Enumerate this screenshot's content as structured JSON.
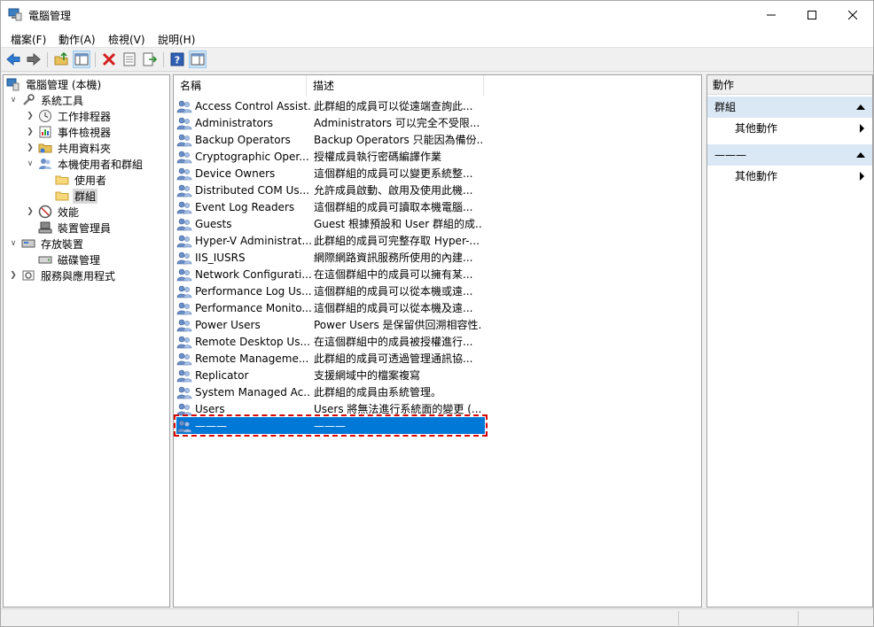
{
  "window": {
    "title": "電腦管理"
  },
  "menubar": {
    "items": [
      "檔案(F)",
      "動作(A)",
      "檢視(V)",
      "說明(H)"
    ]
  },
  "toolbar": {
    "buttons": [
      "back-icon",
      "forward-icon",
      "up-folder-icon",
      "show-hide-tree-icon",
      "delete-icon",
      "properties-icon",
      "export-icon",
      "help-icon",
      "show-hide-action-icon"
    ]
  },
  "tree": {
    "items": [
      {
        "label": "電腦管理 (本機)",
        "icon": "computer-management-icon"
      },
      {
        "label": "系統工具",
        "icon": "tools-icon"
      },
      {
        "label": "工作排程器",
        "icon": "clock-icon"
      },
      {
        "label": "事件檢視器",
        "icon": "event-viewer-icon"
      },
      {
        "label": "共用資料夾",
        "icon": "shared-folder-icon"
      },
      {
        "label": "本機使用者和群組",
        "icon": "users-groups-icon"
      },
      {
        "label": "使用者",
        "icon": "folder-icon"
      },
      {
        "label": "群組",
        "icon": "folder-icon"
      },
      {
        "label": "效能",
        "icon": "performance-icon"
      },
      {
        "label": "裝置管理員",
        "icon": "device-manager-icon"
      },
      {
        "label": "存放裝置",
        "icon": "storage-icon"
      },
      {
        "label": "磁碟管理",
        "icon": "disk-icon"
      },
      {
        "label": "服務與應用程式",
        "icon": "services-icon"
      }
    ]
  },
  "list": {
    "columns": {
      "name": "名稱",
      "desc": "描述"
    },
    "rows": [
      {
        "name": "Access Control Assist...",
        "desc": "此群組的成員可以從遠端查詢此..."
      },
      {
        "name": "Administrators",
        "desc": "Administrators 可以完全不受限..."
      },
      {
        "name": "Backup Operators",
        "desc": "Backup Operators 只能因為備份..."
      },
      {
        "name": "Cryptographic Oper...",
        "desc": "授權成員執行密碼編譯作業"
      },
      {
        "name": "Device Owners",
        "desc": "這個群組的成員可以變更系統整..."
      },
      {
        "name": "Distributed COM Us...",
        "desc": "允許成員啟動、啟用及使用此機..."
      },
      {
        "name": "Event Log Readers",
        "desc": "這個群組的成員可讀取本機電腦..."
      },
      {
        "name": "Guests",
        "desc": "Guest 根據預設和 User 群組的成..."
      },
      {
        "name": "Hyper-V Administrat...",
        "desc": "此群組的成員可完整存取 Hyper-..."
      },
      {
        "name": "IIS_IUSRS",
        "desc": "網際網路資訊服務所使用的內建..."
      },
      {
        "name": "Network Configurati...",
        "desc": "在這個群組中的成員可以擁有某..."
      },
      {
        "name": "Performance Log Us...",
        "desc": "這個群組的成員可以從本機或遠..."
      },
      {
        "name": "Performance Monito...",
        "desc": "這個群組的成員可以從本機及遠..."
      },
      {
        "name": "Power Users",
        "desc": "Power Users 是保留供回溯相容性..."
      },
      {
        "name": "Remote Desktop Us...",
        "desc": "在這個群組中的成員被授權進行..."
      },
      {
        "name": "Remote Manageme...",
        "desc": "此群組的成員可透過管理通訊協..."
      },
      {
        "name": "Replicator",
        "desc": "支援網域中的檔案複寫"
      },
      {
        "name": "System Managed Ac...",
        "desc": "此群組的成員由系統管理。"
      },
      {
        "name": "Users",
        "desc": "Users 將無法進行系統面的變更 (..."
      },
      {
        "name": "———",
        "desc": "———"
      }
    ]
  },
  "actions": {
    "title": "動作",
    "sections": [
      {
        "title": "群組",
        "item": "其他動作"
      },
      {
        "title": "———",
        "item": "其他動作"
      }
    ]
  },
  "colors": {
    "selection": "#0078d7",
    "highlight_outline": "#d60000",
    "section_bg": "#dae8f5"
  }
}
